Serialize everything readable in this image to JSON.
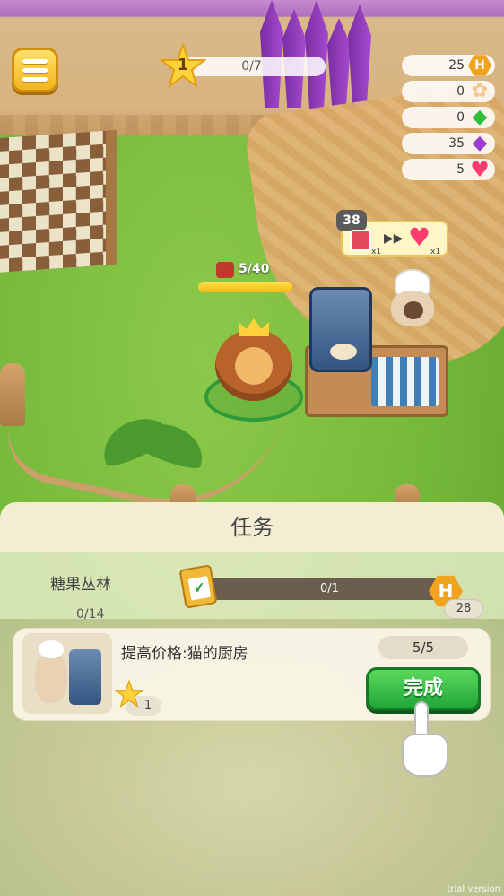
{
  "hud": {
    "level": "1",
    "xp": "0/7",
    "resources": [
      {
        "name": "honey-coin",
        "icon": "hex-coin-icon",
        "value": "25",
        "color": "#f1a21f"
      },
      {
        "name": "flower",
        "icon": "flower-icon",
        "value": "0",
        "color": "#f6c58a"
      },
      {
        "name": "green-gem",
        "icon": "green-gem-icon",
        "value": "0",
        "color": "#2fbf3a"
      },
      {
        "name": "purple-gem",
        "icon": "purple-gem-icon",
        "value": "35",
        "color": "#9b3fd1"
      },
      {
        "name": "heart",
        "icon": "heart-icon",
        "value": "5",
        "color": "#ff3c6e"
      }
    ]
  },
  "world": {
    "order_count": "38",
    "order_input_qty": "x1",
    "order_output_qty": "x1",
    "worker_capacity": "5/40",
    "worker_energy": 1
  },
  "task_panel": {
    "title": "任务",
    "chapter": {
      "name": "糖果丛林",
      "count": "0/14",
      "progress": "0/1",
      "reward": "28",
      "reward_icon": "H"
    },
    "task": {
      "title": "提高价格:猫的厨房",
      "progress": "5/5",
      "star_reward": "1",
      "button": "完成"
    }
  },
  "watermark": "trial version"
}
